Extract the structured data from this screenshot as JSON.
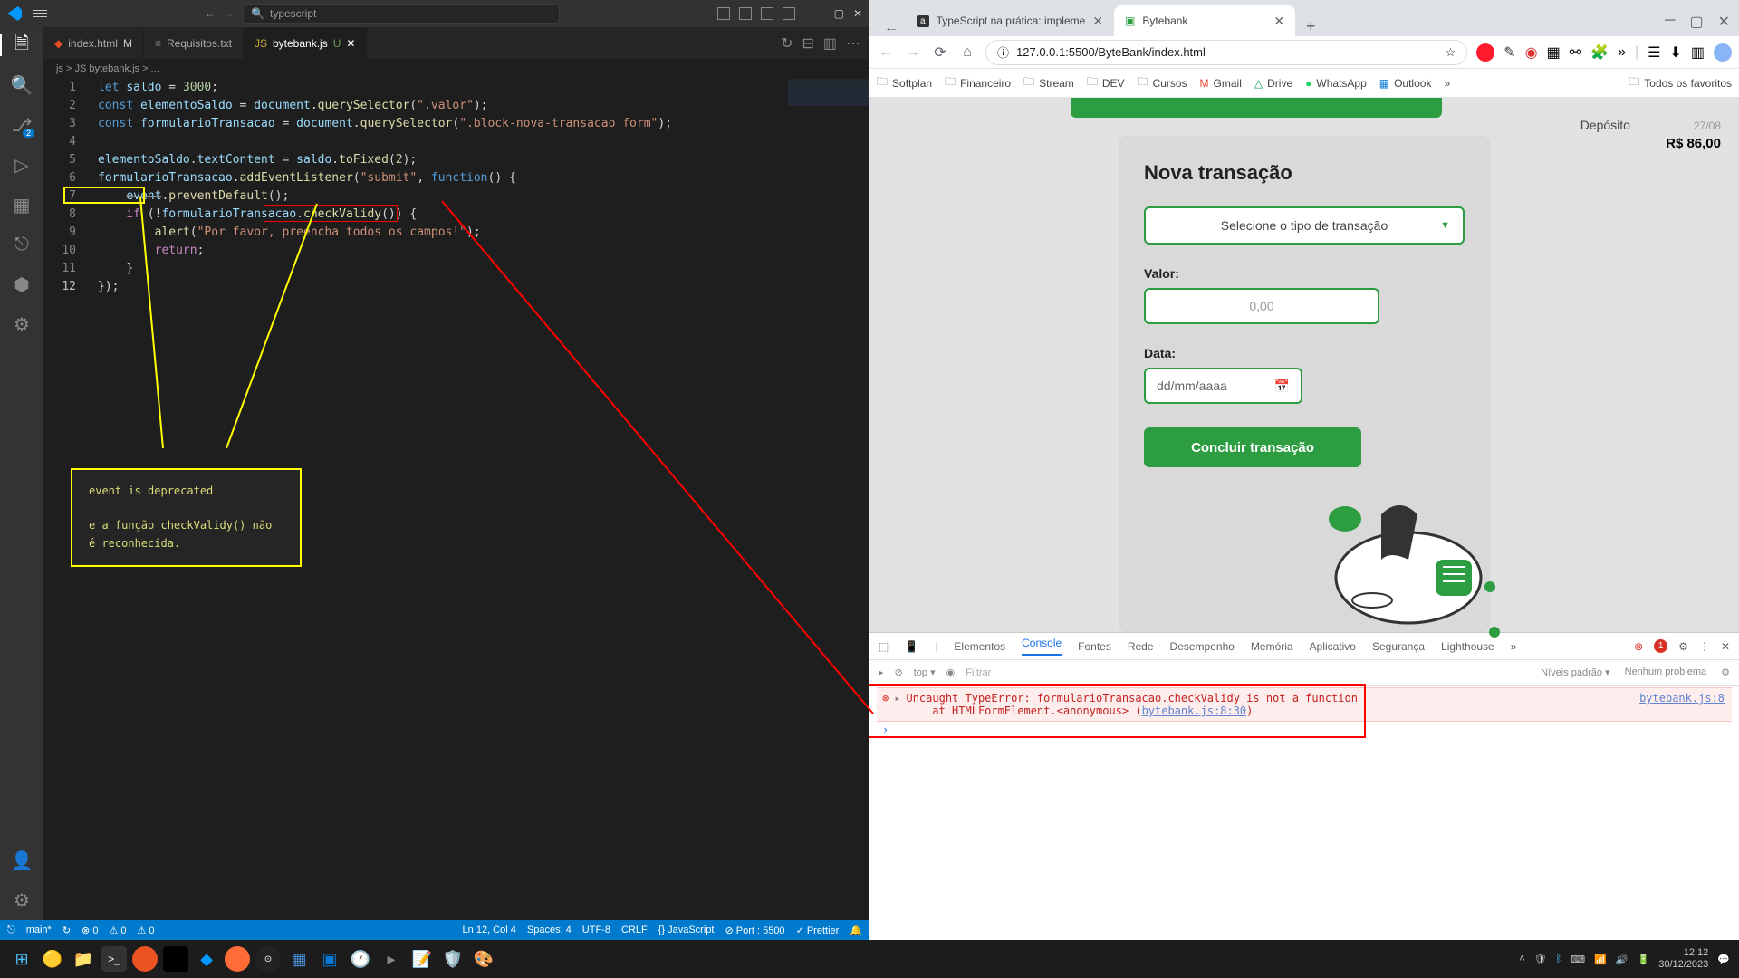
{
  "vscode": {
    "search_placeholder": "typescript",
    "tabs": [
      {
        "name": "index.html",
        "modifier": "M",
        "icon_color": "#e34c26"
      },
      {
        "name": "Requisitos.txt",
        "modifier": "",
        "icon_color": "#888"
      },
      {
        "name": "bytebank.js",
        "modifier": "U",
        "icon_color": "#f7df1e",
        "active": true
      }
    ],
    "breadcrumb": "js > JS bytebank.js > ...",
    "code_lines": [
      "let saldo = 3000;",
      "const elementoSaldo = document.querySelector(\".valor\");",
      "const formularioTransacao = document.querySelector(\".block-nova-transacao form\");",
      "",
      "elementoSaldo.textContent = saldo.toFixed(2);",
      "formularioTransacao.addEventListener(\"submit\", function() {",
      "    event.preventDefault();",
      "    if (!formularioTransacao.checkValidy()) {",
      "        alert(\"Por favor, preencha todos os campos!\");",
      "        return;",
      "    }",
      "});"
    ],
    "line_count": 12,
    "source_control_badge": "2",
    "annotation": {
      "line1": "event is deprecated",
      "line2": "e a função checkValidy() não é reconhecida."
    },
    "status": {
      "branch": "main*",
      "errors": "⊗ 0",
      "warnings": "⚠ 0",
      "port_warn": "⚠ 0",
      "line_col": "Ln 12, Col 4",
      "spaces": "Spaces: 4",
      "encoding": "UTF-8",
      "eol": "CRLF",
      "lang": "{} JavaScript",
      "port": "⊘ Port : 5500",
      "prettier": "✓ Prettier"
    }
  },
  "browser": {
    "tabs": [
      {
        "title": "TypeScript na prática: impleme",
        "favicon": "a"
      },
      {
        "title": "Bytebank",
        "favicon": "▣",
        "active": true
      }
    ],
    "url": "127.0.0.1:5500/ByteBank/index.html",
    "bookmarks": [
      "Softplan",
      "Financeiro",
      "Stream",
      "DEV",
      "Cursos",
      "Gmail",
      "Drive",
      "WhatsApp",
      "Outlook"
    ],
    "bookmarks_more": "»",
    "bookmarks_all": "Todos os favoritos",
    "page": {
      "sidebar_title": "Depósito",
      "sidebar_date": "27/08",
      "sidebar_amount": "R$ 86,00",
      "card_title": "Nova transação",
      "select_placeholder": "Selecione o tipo de transação",
      "valor_label": "Valor:",
      "valor_placeholder": "0,00",
      "data_label": "Data:",
      "data_placeholder": "dd/mm/aaaa",
      "submit_label": "Concluir transação"
    },
    "devtools": {
      "tabs": [
        "Elementos",
        "Console",
        "Fontes",
        "Rede",
        "Desempenho",
        "Memória",
        "Aplicativo",
        "Segurança",
        "Lighthouse"
      ],
      "more": "»",
      "err_count": "1",
      "filter_placeholder": "Filtrar",
      "levels": "Níveis padrão ▾",
      "no_problem": "Nenhum problema",
      "error_msg": "Uncaught TypeError: formularioTransacao.checkValidy is not a function",
      "error_at": "at HTMLFormElement.<anonymous> (",
      "error_link": "bytebank.js:8:30",
      "error_src": "bytebank.js:8",
      "top_label": "top ▾"
    }
  },
  "taskbar": {
    "time": "12:12",
    "date": "30/12/2023"
  }
}
